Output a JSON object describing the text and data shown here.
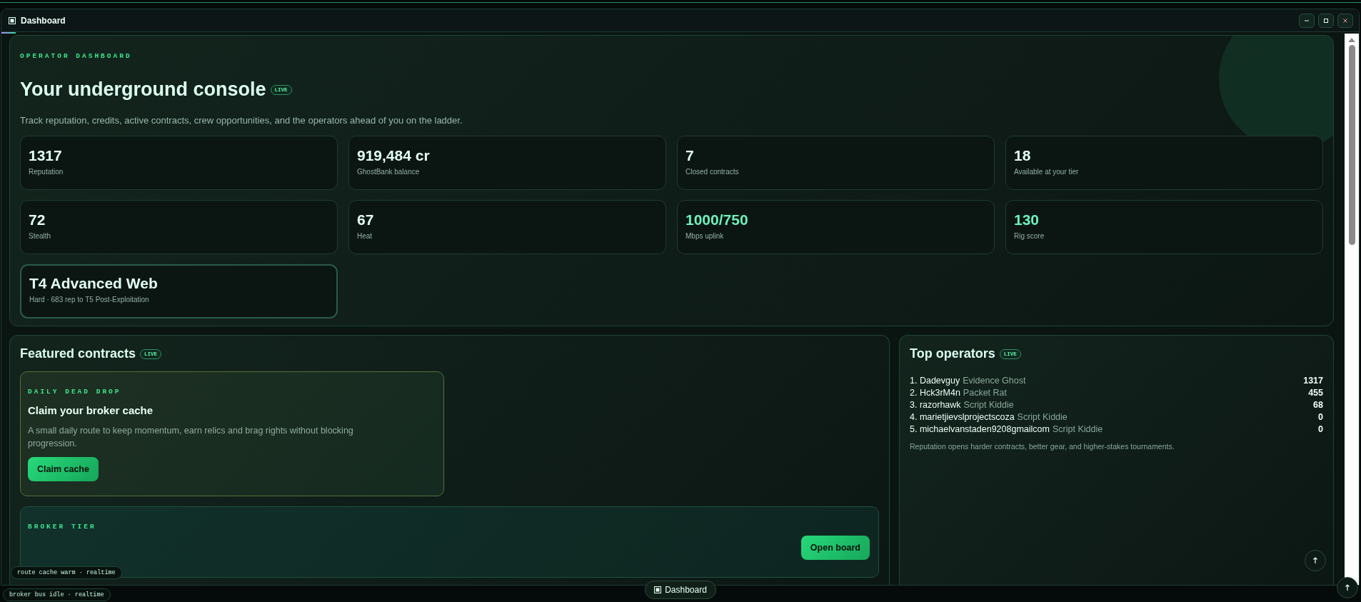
{
  "window": {
    "title": "Dashboard"
  },
  "hero": {
    "eyebrow": "OPERATOR DASHBOARD",
    "title": "Your underground console",
    "badge": "LIVE",
    "subtitle": "Track reputation, credits, active contracts, crew opportunities, and the operators ahead of you on the ladder.",
    "stats": [
      {
        "kind": "plain",
        "value": "1317",
        "label": "Reputation"
      },
      {
        "kind": "plain",
        "value": "919,484 cr",
        "label": "GhostBank balance"
      },
      {
        "kind": "plain",
        "value": "7",
        "label": "Closed contracts"
      },
      {
        "kind": "plain",
        "value": "18",
        "label": "Available at your tier"
      },
      {
        "kind": "plain",
        "value": "72",
        "label": "Stealth"
      },
      {
        "kind": "plain",
        "value": "67",
        "label": "Heat"
      },
      {
        "kind": "highlight",
        "value": "1000/750",
        "label": "Mbps uplink"
      },
      {
        "kind": "highlight",
        "value": "130",
        "label": "Rig score"
      },
      {
        "kind": "tier",
        "value": "T4 Advanced Web",
        "label": "Hard · 683 rep to T5 Post-Exploitation"
      }
    ]
  },
  "featured": {
    "title": "Featured contracts",
    "badge": "LIVE",
    "daily": {
      "eyebrow": "DAILY DEAD DROP",
      "title": "Claim your broker cache",
      "text": "A small daily route to keep momentum, earn relics and brag rights without blocking progression.",
      "button": "Claim cache"
    },
    "broker": {
      "eyebrow": "BROKER TIER",
      "button": "Open board"
    }
  },
  "operators": {
    "title": "Top operators",
    "badge": "LIVE",
    "rows": [
      {
        "rank": "1.",
        "name": "Dadevguy",
        "rank_title": "Evidence Ghost",
        "score": "1317"
      },
      {
        "rank": "2.",
        "name": "Hck3rM4n",
        "rank_title": "Packet Rat",
        "score": "455"
      },
      {
        "rank": "3.",
        "name": "razorhawk",
        "rank_title": "Script Kiddie",
        "score": "68"
      },
      {
        "rank": "4.",
        "name": "marietjievslprojectscoza",
        "rank_title": "Script Kiddie",
        "score": "0"
      },
      {
        "rank": "5.",
        "name": "michaelvanstaden9208gmailcom",
        "rank_title": "Script Kiddie",
        "score": "0"
      }
    ],
    "note": "Reputation opens harder contracts, better gear, and higher-stakes tournaments."
  },
  "status_pills": [
    "route cache warm · realtime",
    "broker bus idle · realtime"
  ],
  "taskbar": {
    "item": "Dashboard"
  }
}
